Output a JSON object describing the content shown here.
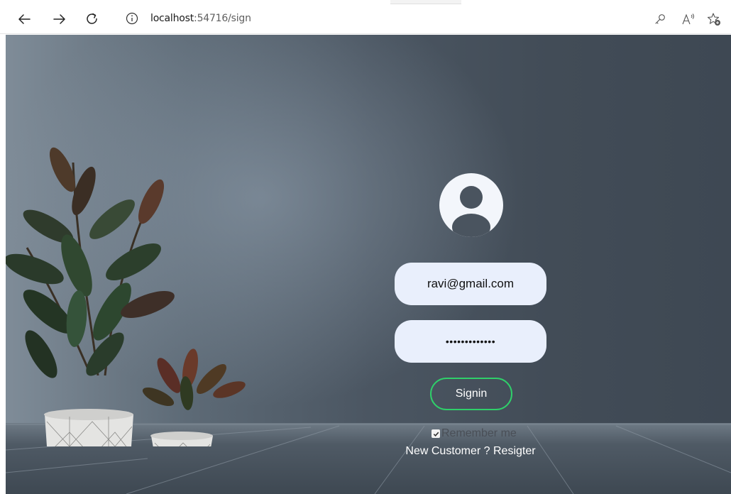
{
  "browser": {
    "url_host": "localhost",
    "url_path": ":54716/sign",
    "icons": {
      "back": "arrow-left-icon",
      "forward": "arrow-right-icon",
      "refresh": "refresh-icon",
      "info": "info-icon",
      "password": "key-icon",
      "read_aloud": "read-aloud-icon",
      "favorites": "add-favorite-icon"
    }
  },
  "signin": {
    "email_value": "ravi@gmail.com",
    "password_value": "•••••••••••••",
    "button_label": "Signin",
    "remember_label": "Remember me",
    "remember_checked": true,
    "register_prefix": "New Customer ? ",
    "register_link": "Resigter",
    "avatar_icon": "user-avatar-icon"
  },
  "colors": {
    "button_border": "#2fcf6a",
    "input_bg": "#e9effc",
    "avatar_bg": "#f3f6fb",
    "wall_dark": "#424c57"
  }
}
